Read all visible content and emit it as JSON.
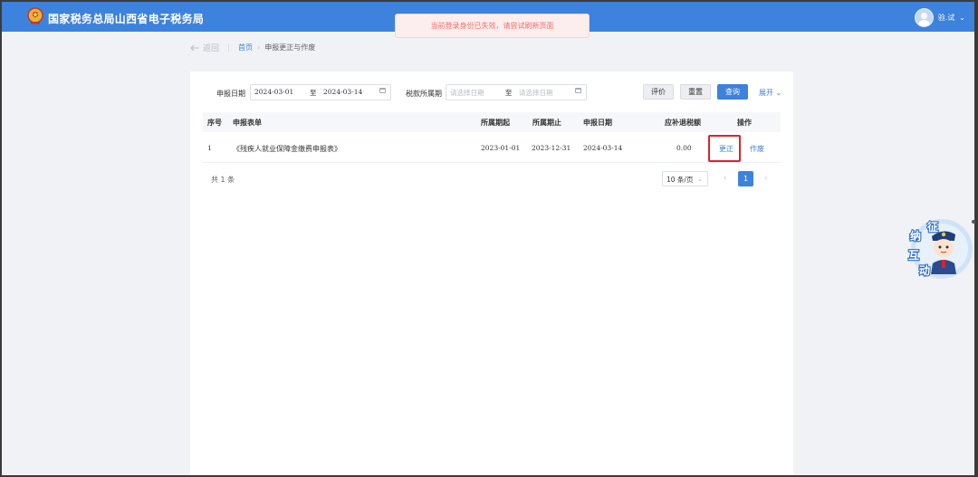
{
  "app": {
    "title": "国家税务总局山西省电子税务局"
  },
  "user": {
    "name": "验.试",
    "caret": "⌄"
  },
  "toast": {
    "message": "当前登录身份已失效，请尝试刷新页面"
  },
  "breadcrumb": {
    "back": "返回",
    "home": "首页",
    "sep": "›",
    "current": "申报更正与作废"
  },
  "filters": {
    "declare_date_label": "申报日期",
    "declare_start": "2024-03-01",
    "declare_to": "至",
    "declare_end": "2024-03-14",
    "period_label": "税款所属期",
    "period_start_placeholder": "请选择日期",
    "period_to": "至",
    "period_end_placeholder": "请选择日期"
  },
  "buttons": {
    "evaluate": "评价",
    "reset": "重置",
    "query": "查询",
    "expand": "展开 ⌄"
  },
  "table": {
    "headers": {
      "index": "序号",
      "form": "申报表单",
      "period_start": "所属期起",
      "period_end": "所属期止",
      "declare_date": "申报日期",
      "amount": "应补退税额",
      "action": "操作"
    },
    "rows": [
      {
        "index": "1",
        "form": "《残疾人就业保障金缴费申报表》",
        "period_start": "2023-01-01",
        "period_end": "2023-12-31",
        "declare_date": "2024-03-14",
        "amount": "0.00",
        "correct": "更正",
        "void": "作废"
      }
    ]
  },
  "pagination": {
    "total": "共 1 条",
    "page_size": "10 条/页",
    "current": "1",
    "prev": "‹",
    "next": "›"
  },
  "mascot": {
    "chars": [
      "征",
      "纳",
      "互",
      "动"
    ]
  },
  "colors": {
    "primary": "#3d82dc",
    "highlight": "#d9232e",
    "toast_text": "#f56c6c"
  },
  "icons": {
    "logo": "tax-emblem-icon",
    "back": "arrow-left-icon",
    "calendar": "calendar-icon",
    "avatar": "user-avatar-icon"
  }
}
